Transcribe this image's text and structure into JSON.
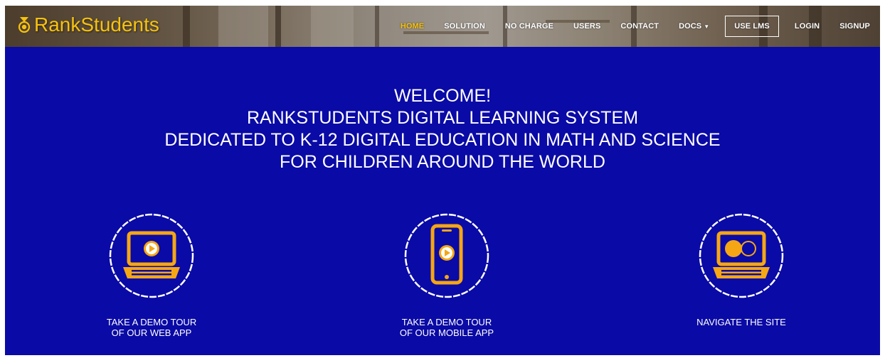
{
  "brand": {
    "name": "RankStudents",
    "color": "#f6c20e"
  },
  "nav": {
    "items": [
      {
        "label": "HOME",
        "active": true
      },
      {
        "label": "SOLUTION"
      },
      {
        "label": "NO CHARGE"
      },
      {
        "label": "USERS"
      },
      {
        "label": "CONTACT"
      },
      {
        "label": "DOCS",
        "has_dropdown": true
      },
      {
        "label": "USE LMS",
        "boxed": true
      },
      {
        "label": "LOGIN"
      },
      {
        "label": "SIGNUP"
      }
    ]
  },
  "hero": {
    "background": "#0a0aa6",
    "headline": [
      "WELCOME!",
      "RANKSTUDENTS DIGITAL LEARNING SYSTEM",
      "DEDICATED TO K-12 DIGITAL EDUCATION IN MATH AND SCIENCE",
      "FOR CHILDREN AROUND THE WORLD"
    ]
  },
  "features": [
    {
      "icon": "laptop-play-icon",
      "label_lines": [
        "TAKE A DEMO TOUR",
        "OF OUR WEB APP"
      ]
    },
    {
      "icon": "phone-play-icon",
      "label_lines": [
        "TAKE A DEMO TOUR",
        "OF OUR MOBILE APP"
      ]
    },
    {
      "icon": "laptop-navigate-icon",
      "label_lines": [
        "NAVIGATE THE SITE"
      ]
    }
  ],
  "icon_colors": {
    "accent": "#f5a614",
    "circle": "#ffffff"
  }
}
